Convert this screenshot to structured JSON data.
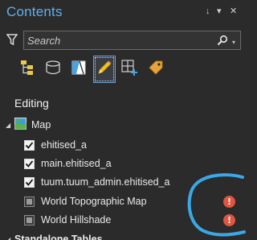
{
  "pane": {
    "title": "Contents",
    "controls": {
      "pin": "↓",
      "dropdown": "▾",
      "close": "✕"
    }
  },
  "search": {
    "placeholder": "Search"
  },
  "toolbar": {
    "buttons": [
      {
        "name": "list-by-drawing-order",
        "icon": "drawing-order-icon"
      },
      {
        "name": "list-by-source",
        "icon": "database-icon"
      },
      {
        "name": "list-by-selection",
        "icon": "selection-icon"
      },
      {
        "name": "list-by-editing",
        "icon": "pencil-icon",
        "active": true
      },
      {
        "name": "list-by-snapping",
        "icon": "snapping-icon"
      },
      {
        "name": "list-by-labeling",
        "icon": "label-tag-icon"
      }
    ]
  },
  "section": {
    "heading": "Editing"
  },
  "tree": {
    "map": {
      "label": "Map",
      "expanded": true
    },
    "layers": [
      {
        "label": "ehitised_a",
        "checked": true,
        "editable": true,
        "warning": false
      },
      {
        "label": "main.ehitised_a",
        "checked": true,
        "editable": true,
        "warning": false
      },
      {
        "label": "tuum.tuum_admin.ehitised_a",
        "checked": true,
        "editable": true,
        "warning": false
      },
      {
        "label": "World Topographic Map",
        "checked": false,
        "editable": false,
        "warning": true
      },
      {
        "label": "World Hillshade",
        "checked": false,
        "editable": false,
        "warning": true
      }
    ],
    "next_group": {
      "label": "Standalone Tables",
      "expanded": true
    }
  },
  "colors": {
    "accent": "#5fb0ee",
    "warning": "#e0553f",
    "annotation": "#3aa8e6",
    "background": "#2b2b2b"
  }
}
